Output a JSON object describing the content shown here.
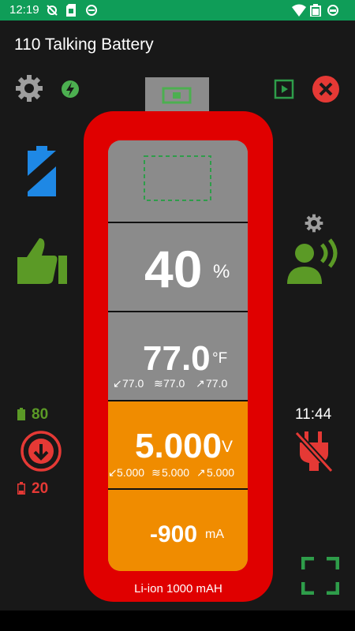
{
  "status_bar": {
    "time": "12:19",
    "icons": [
      "no-alarm-icon",
      "sim-card-icon",
      "sync-icon",
      "wifi-icon",
      "battery-full-icon",
      "circle-icon"
    ]
  },
  "app": {
    "title": "110 Talking Battery"
  },
  "toolbar": {
    "settings_icon": "gear-icon",
    "charging_icon": "leaf-bolt-icon",
    "play_icon": "play-box-icon",
    "close_icon": "close-circle-icon"
  },
  "battery": {
    "cap_icon": "screen-icon",
    "level_percent": "40",
    "level_unit": "%",
    "temperature": "77.0",
    "temperature_unit": "°F",
    "temperature_min": "77.0",
    "temperature_avg": "77.0",
    "temperature_max": "77.0",
    "voltage": "5.000",
    "voltage_unit": "V",
    "voltage_min": "5.000",
    "voltage_avg": "5.000",
    "voltage_max": "5.000",
    "current": "-900",
    "current_unit": "mA",
    "label": "Li-ion 1000 mAH"
  },
  "left_panel": {
    "battery_icon": "battery-half-icon",
    "health_icon": "thumbs-up-icon",
    "high_threshold": "80",
    "low_threshold": "20",
    "charge_down_icon": "down-arrow-circle-icon"
  },
  "right_panel": {
    "voice_settings_icon": "gear-icon",
    "speaker_icon": "person-speaking-icon",
    "clock": "11:44",
    "unplugged_icon": "power-plug-off-icon",
    "fullscreen_icon": "fullscreen-icon"
  },
  "colors": {
    "status_bar": "#0f9d58",
    "battery_red": "#e00000",
    "grey_segment": "#8b8b8b",
    "orange_segment": "#f08c00",
    "green": "#5b9a26",
    "red": "#e53935"
  }
}
